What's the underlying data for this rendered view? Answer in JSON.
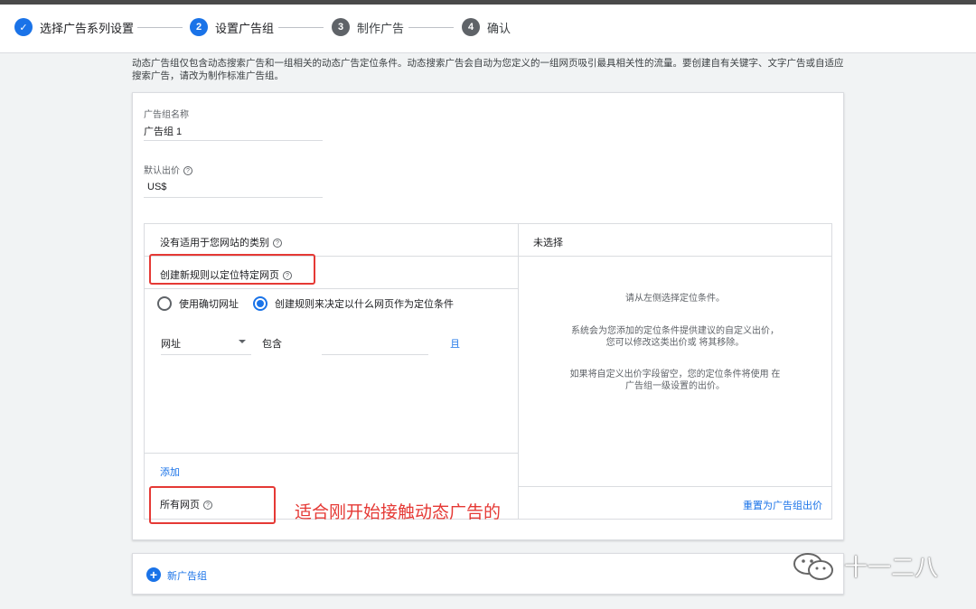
{
  "stepper": {
    "steps": [
      {
        "number": "✓",
        "label": "选择广告系列设置",
        "state": "done"
      },
      {
        "number": "2",
        "label": "设置广告组",
        "state": "active"
      },
      {
        "number": "3",
        "label": "制作广告",
        "state": "todo"
      },
      {
        "number": "4",
        "label": "确认",
        "state": "todo"
      }
    ]
  },
  "intro": {
    "text": "动态广告组仅包含动态搜索广告和一组相关的动态广告定位条件。动态搜索广告会自动为您定义的一组网页吸引最具相关性的流量。要创建自有关键字、文字广告或自适应搜索广告，请改为制作标准广告组。"
  },
  "ad_group": {
    "name_label": "广告组名称",
    "name_value": "广告组 1",
    "bid_label": "默认出价",
    "bid_value": "US$"
  },
  "targeting": {
    "no_category_label": "没有适用于您网站的类别",
    "create_rule_label": "创建新规则以定位特定网页",
    "radio_exact_url": "使用确切网址",
    "radio_rules": "创建规则来决定以什么网页作为定位条件",
    "condition_field": "网址",
    "condition_operator": "包含",
    "condition_and": "且",
    "add_label": "添加",
    "all_pages_label": "所有网页",
    "right_header": "未选择",
    "right_text_1": "请从左侧选择定位条件。",
    "right_text_2a": "系统会为您添加的定位条件提供建议的自定义出价，",
    "right_text_2b": "您可以修改这类出价或 将其移除。",
    "right_text_3a": "如果将自定义出价字段留空，您的定位条件将使用 在",
    "right_text_3b": "广告组一级设置的出价。",
    "reset_label": "重置为广告组出价"
  },
  "annotation": {
    "text": "适合刚开始接触动态广告的"
  },
  "new_group": {
    "label": "新广告组"
  },
  "watermark": {
    "text": "十一二八"
  },
  "colors": {
    "accent": "#1a73e8",
    "annotation_red": "#e53935"
  }
}
